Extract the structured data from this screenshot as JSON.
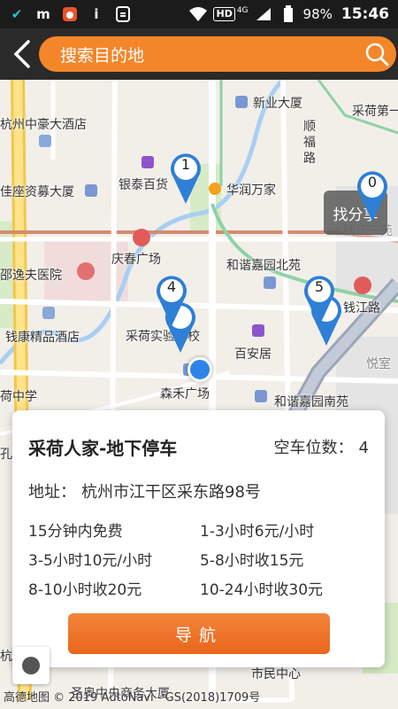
{
  "status_bar": {
    "battery": "98%",
    "time": "15:46",
    "network": "HD",
    "signal_gen": "4G"
  },
  "header": {
    "search_placeholder": "搜索目的地"
  },
  "map": {
    "share_button": "找分享",
    "labels": {
      "l1": "新业大厦",
      "l2": "杭州中豪大酒店",
      "l3": "顺",
      "l4": "福",
      "l5": "路",
      "l6": "银泰百货",
      "l7": "华润万家",
      "l8": "佳座资募大厦",
      "l9": "庆春广场",
      "l10": "和谐嘉园北苑",
      "l11": "邵逸夫医院",
      "l12": "钱江路",
      "l13": "钱康精品酒店",
      "l14": "采荷实验学校",
      "l15": "百安居",
      "l16": "悦室",
      "l17": "森禾广场",
      "l18": "和谐嘉园南苑",
      "l19": "荷中学",
      "l20": "钱江三苑",
      "l21": "采荷第一",
      "l22": "市民中心",
      "l23": "孔",
      "l24": "杭",
      "l25": "圣奥中央商务大厦",
      "l26": "钱江路"
    },
    "pins": [
      "1",
      "0",
      "4",
      "5"
    ],
    "copyright": "高德地图 © 2019 AutoNavi - GS(2018)1709号"
  },
  "card": {
    "title": "采荷人家-地下停车",
    "spaces_label": "空车位数：",
    "spaces_value": "4",
    "address_label": "地址：",
    "address": "杭州市江干区采东路98号",
    "fees": [
      "15分钟内免费",
      "1-3小时6元/小时",
      "3-5小时10元/小时",
      "5-8小时收15元",
      "8-10小时收20元",
      "10-24小时收30元"
    ],
    "nav_button": "导航"
  }
}
